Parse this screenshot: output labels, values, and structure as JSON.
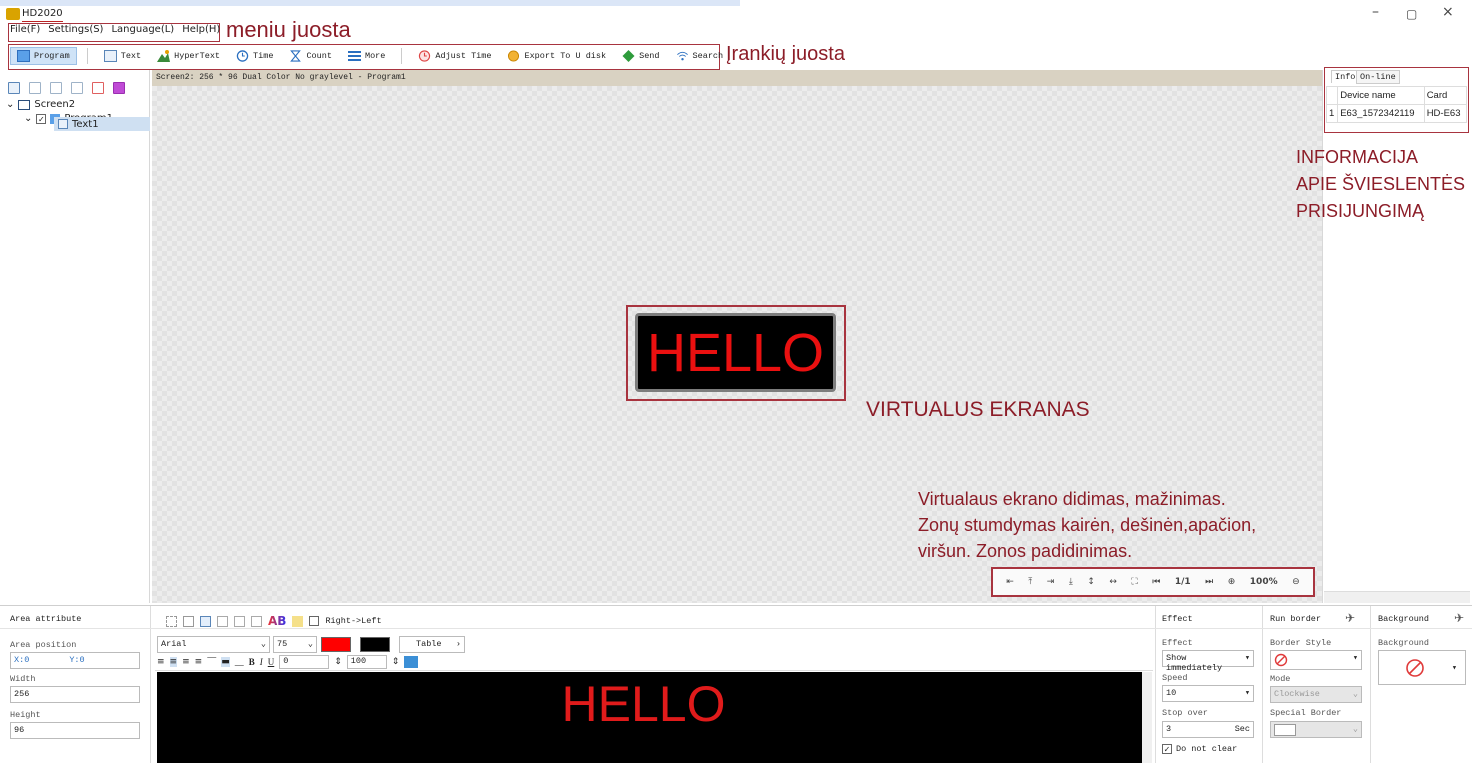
{
  "window": {
    "title": "HD2020",
    "minimize": "–",
    "maximize": "▢",
    "close": "×"
  },
  "menu": {
    "items": [
      "File(F)",
      "Settings(S)",
      "Language(L)",
      "Help(H)"
    ],
    "annotation": "meniu juosta"
  },
  "toolbar": {
    "annotation": "Įrankių juosta",
    "buttons": [
      {
        "label": "Program",
        "icon": "program-icon"
      },
      {
        "label": "Text",
        "icon": "text-icon"
      },
      {
        "label": "HyperText",
        "icon": "hypertext-icon"
      },
      {
        "label": "Time",
        "icon": "clock-icon"
      },
      {
        "label": "Count",
        "icon": "hourglass-icon"
      },
      {
        "label": "More",
        "icon": "more-icon"
      },
      {
        "label": "Adjust Time",
        "icon": "adjust-time-icon"
      },
      {
        "label": "Export To U disk",
        "icon": "export-icon"
      },
      {
        "label": "Send",
        "icon": "send-icon"
      },
      {
        "label": "Search",
        "icon": "search-icon"
      }
    ]
  },
  "tree": {
    "screen": "Screen2",
    "program": "Program1",
    "text": "Text1"
  },
  "canvas": {
    "header": "Screen2: 256 * 96 Dual Color No graylevel - Program1",
    "hello": "HELLO",
    "annotation_virtual": "VIRTUALUS EKRANAS",
    "annotation_zoom": [
      "Virtualaus ekrano didimas, mažinimas.",
      "Zonų stumdymas kairėn, dešinėn,apačion,",
      "viršun. Zonos padidinimas."
    ],
    "page": "1/1",
    "zoom": "100%"
  },
  "right_panel": {
    "tabs": [
      "Info",
      "On-line"
    ],
    "columns": [
      "Device name",
      "Card"
    ],
    "rows": [
      {
        "index": "1",
        "device": "E63_1572342119",
        "card": "HD-E63"
      }
    ],
    "annotation": [
      "INFORMACIJA",
      "APIE ŠVIESLENTĖS",
      "PRISIJUNGIMĄ"
    ]
  },
  "area_attribute": {
    "title": "Area attribute",
    "position_label": "Area position",
    "x": "X:0",
    "y": "Y:0",
    "width_label": "Width",
    "width": "256",
    "height_label": "Height",
    "height": "96"
  },
  "text_editor": {
    "direction": "Right->Left",
    "ab": "AB",
    "font": "Arial",
    "size": "75",
    "table_btn": "Table",
    "spacing": "0",
    "scale": "100",
    "text_color": "#ff0000",
    "bg_color": "#000000",
    "preview": "HELLO"
  },
  "effect": {
    "title": "Effect",
    "effect_label": "Effect",
    "effect_value": "Show immediately",
    "speed_label": "Speed",
    "speed_value": "10",
    "stop_label": "Stop over",
    "stop_value": "3",
    "stop_unit": "Sec",
    "do_not_clear": "Do not clear"
  },
  "run_border": {
    "title": "Run border",
    "style_label": "Border Style",
    "mode_label": "Mode",
    "mode_value": "Clockwise",
    "special_label": "Special Border"
  },
  "background": {
    "title": "Background",
    "label": "Background"
  }
}
